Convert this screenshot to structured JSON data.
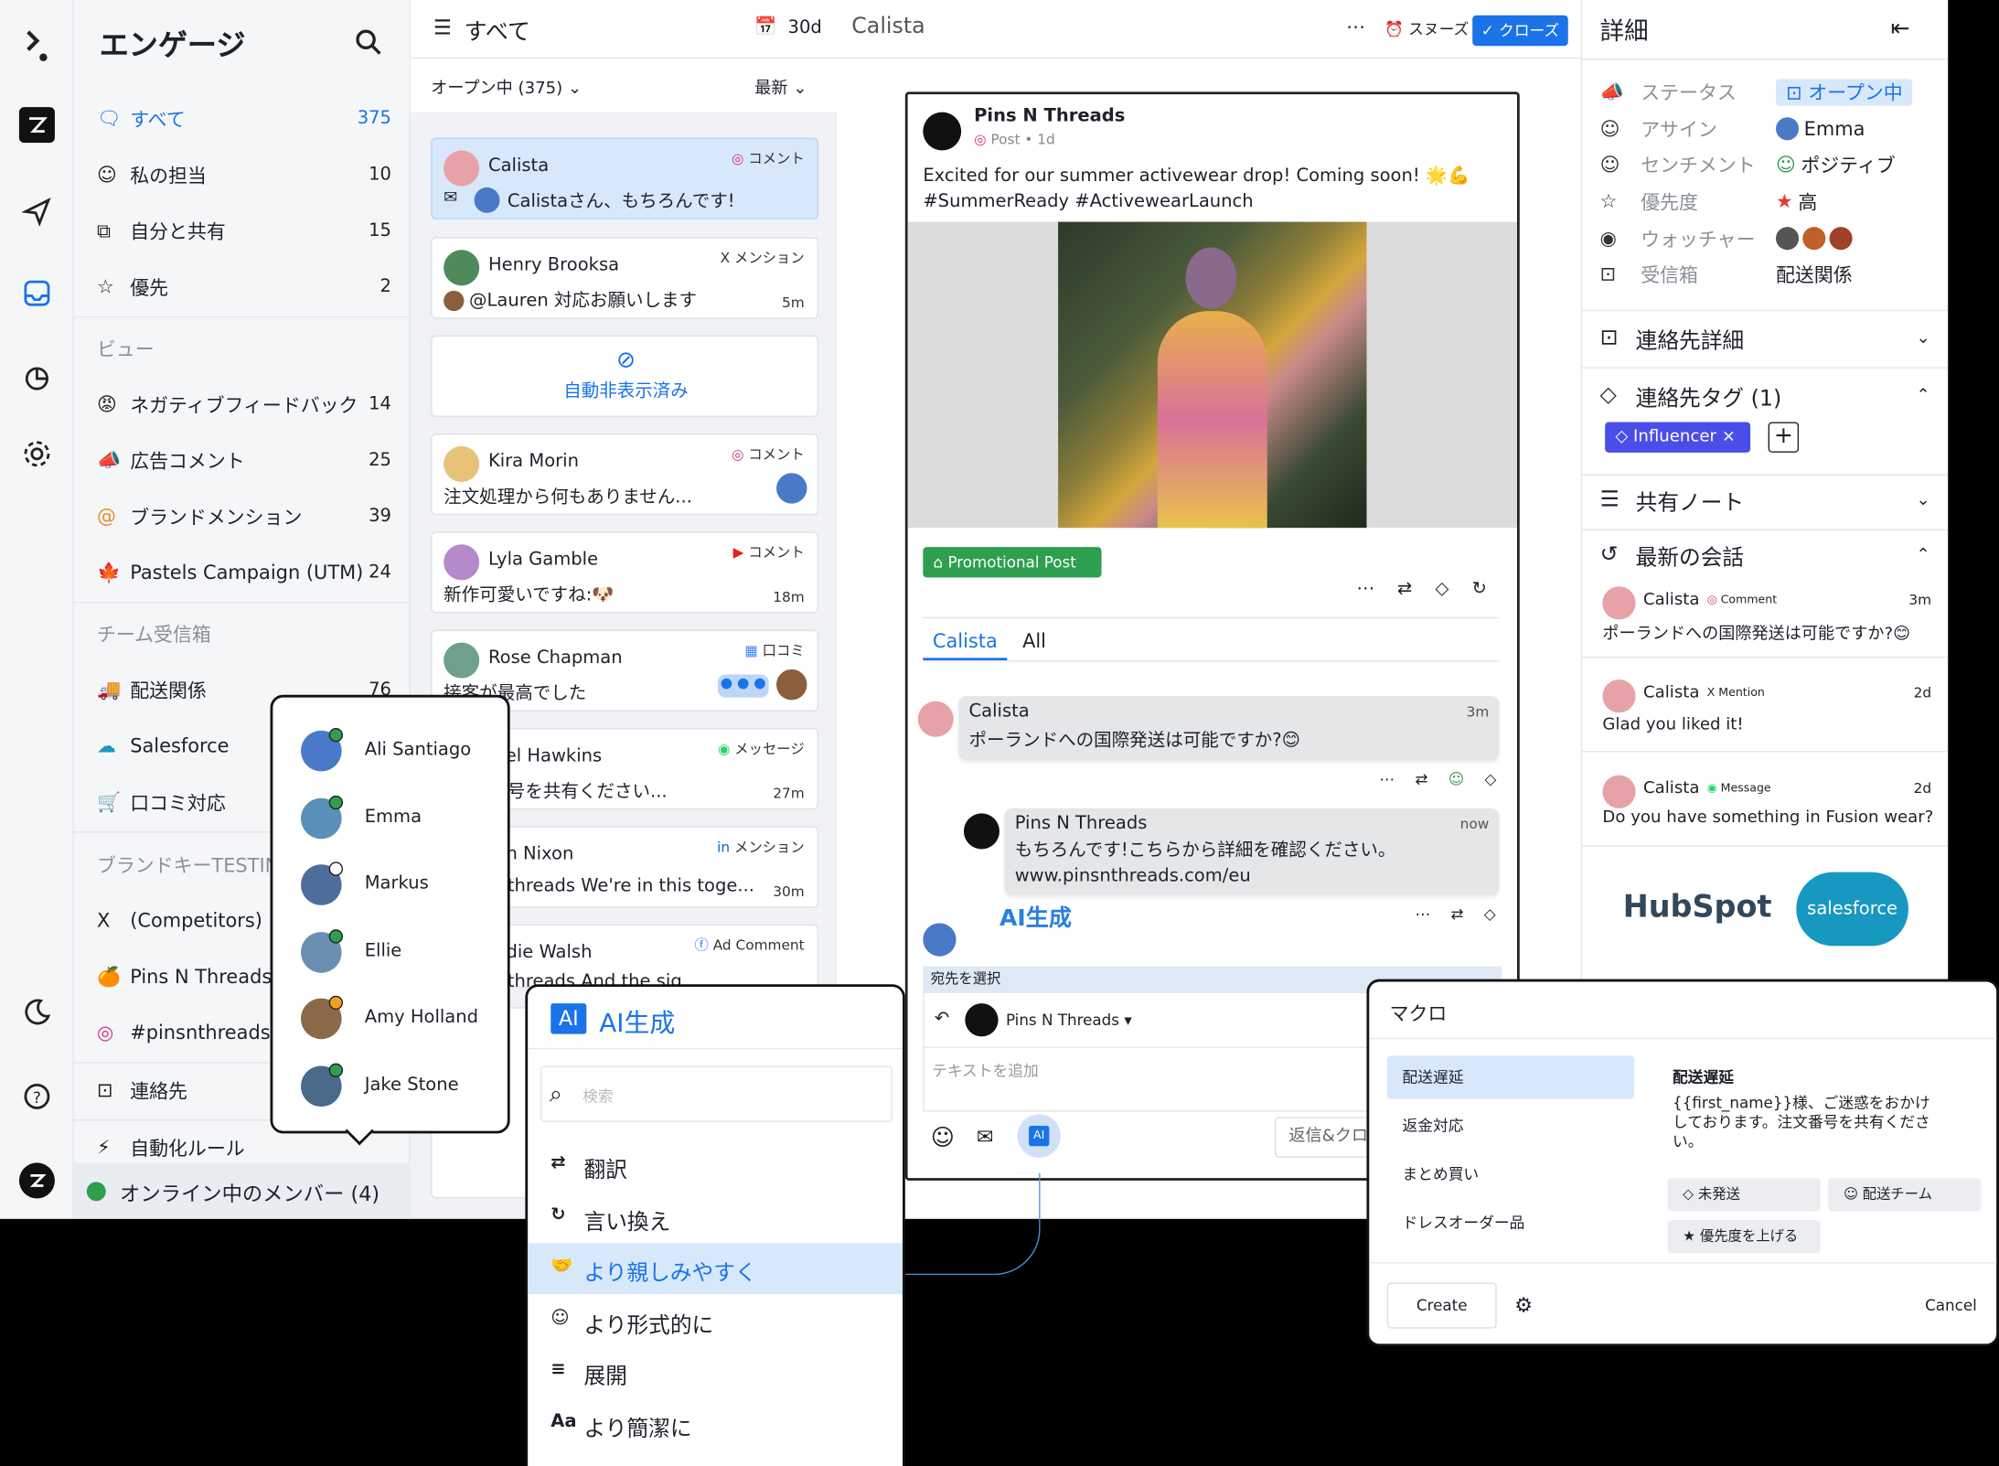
{
  "brand_letter": "ᗘ",
  "sidebar": {
    "title": "エンゲージ",
    "items": [
      {
        "icon": "🗨",
        "label": "すべて",
        "count": "375"
      },
      {
        "icon": "☺",
        "label": "私の担当",
        "count": "10"
      },
      {
        "icon": "⧉",
        "label": "自分と共有",
        "count": "15"
      },
      {
        "icon": "☆",
        "label": "優先",
        "count": "2"
      }
    ],
    "views_header": "ビュー",
    "views": [
      {
        "icon": "😡",
        "label": "ネガティブフィードバック",
        "count": "14"
      },
      {
        "icon": "📣",
        "label": "広告コメント",
        "count": "25"
      },
      {
        "icon": "@",
        "label": "ブランドメンション",
        "count": "39"
      },
      {
        "icon": "🍁",
        "label": "Pastels Campaign (UTM)",
        "count": "24"
      }
    ],
    "team_header": "チーム受信箱",
    "team": [
      {
        "icon": "🚚",
        "label": "配送関係",
        "count": "76"
      },
      {
        "icon": "☁",
        "label": "Salesforce",
        "count": ""
      },
      {
        "icon": "🛒",
        "label": "口コミ対応",
        "count": ""
      }
    ],
    "brand_header": "ブランドキーTESTIN",
    "brand": [
      {
        "icon": "X",
        "label": "(Competitors)"
      },
      {
        "icon": "🍊",
        "label": "Pins N Threads"
      },
      {
        "icon": "◎",
        "label": "#pinsnthreads"
      }
    ],
    "contacts": "連絡先",
    "automation": "自動化ルール",
    "online": "オンライン中のメンバー (4)"
  },
  "members": [
    "Ali Santiago",
    "Emma",
    "Markus",
    "Ellie",
    "Amy Holland",
    "Jake Stone"
  ],
  "list": {
    "title": "すべて",
    "range": "30d",
    "filter": "オープン中 (375)",
    "sort": "最新",
    "cards": [
      {
        "name": "Calista",
        "tag": "コメント",
        "msg": "Calistaさん、もちろんです!",
        "time": ""
      },
      {
        "name": "Henry Brooksa",
        "tag": "メンション",
        "msg": "@Lauren 対応お願いします",
        "time": "5m"
      },
      {
        "name": "Kira Morin",
        "tag": "コメント",
        "msg": "注文処理から何もありません...",
        "time": ""
      },
      {
        "name": "Lyla Gamble",
        "tag": "コメント",
        "msg": "新作可愛いですね:🐶",
        "time": "18m"
      },
      {
        "name": "Rose Chapman",
        "tag": "口コミ",
        "msg": "接客が最高でした",
        "time": ""
      },
      {
        "name": "obel Hawkins",
        "tag": "メッセージ",
        "msg": "号を共有ください...",
        "time": "27m"
      },
      {
        "name": "n Nixon",
        "tag": "メンション",
        "msg": "threads We're in this toge...",
        "time": "30m"
      },
      {
        "name": "die Walsh",
        "tag": "Ad Comment",
        "msg": "threads And the sig",
        "time": ""
      }
    ],
    "auto_hidden": "自動非表示済み"
  },
  "conversation": {
    "title": "Calista",
    "snooze": "スヌーズ",
    "close": "クローズ",
    "post_author": "Pins N Threads",
    "post_meta": "Post • 1d",
    "post_text": "Excited for our summer activewear drop! Coming soon! 🌟💪 #SummerReady #ActivewearLaunch",
    "promo_tag": "Promotional Post",
    "tabs": [
      "Calista",
      "All"
    ],
    "msg1_name": "Calista",
    "msg1_time": "3m",
    "msg1_text": "ポーランドへの国際発送は可能ですか?😊",
    "msg2_name": "Pins N Threads",
    "msg2_time": "now",
    "msg2_text": "もちろんです!こちらから詳細を確認ください。 www.pinsnthreads.com/eu",
    "ai_label": "AI生成",
    "recipient_label": "宛先を選択",
    "recipient": "Pins N Threads",
    "placeholder": "テキストを追加",
    "ai_btn": "AI",
    "reply_close": "返信&クロ"
  },
  "ai_menu": {
    "badge": "AI",
    "title": "AI生成",
    "search_placeholder": "検索",
    "items": [
      {
        "icon": "⇄",
        "label": "翻訳"
      },
      {
        "icon": "↻",
        "label": "言い換え"
      },
      {
        "icon": "🤝",
        "label": "より親しみやすく"
      },
      {
        "icon": "☺",
        "label": "より形式的に"
      },
      {
        "icon": "≡",
        "label": "展開"
      },
      {
        "icon": "Aa",
        "label": "より簡潔に"
      }
    ]
  },
  "details": {
    "title": "詳細",
    "rows": [
      {
        "icon": "📣",
        "label": "ステータス",
        "value": "オープン中"
      },
      {
        "icon": "☺",
        "label": "アサイン",
        "value": "Emma"
      },
      {
        "icon": "☺",
        "label": "センチメント",
        "value": "ポジティブ"
      },
      {
        "icon": "☆",
        "label": "優先度",
        "value": "高"
      },
      {
        "icon": "◉",
        "label": "ウォッチャー",
        "value": ""
      },
      {
        "icon": "⊡",
        "label": "受信箱",
        "value": "配送関係"
      }
    ],
    "contact_details": "連絡先詳細",
    "contact_tags": "連絡先タグ (1)",
    "tag": "Influencer",
    "shared_notes": "共有ノート",
    "recent": "最新の会話",
    "recent_items": [
      {
        "name": "Calista",
        "type": "Comment",
        "time": "3m",
        "text": "ポーランドへの国際発送は可能ですか?😊"
      },
      {
        "name": "Calista",
        "type": "Mention",
        "time": "2d",
        "text": "Glad you liked it!"
      },
      {
        "name": "Calista",
        "type": "Message",
        "time": "2d",
        "text": "Do you have something in Fusion wear?"
      }
    ],
    "hubspot": "HubSpot",
    "salesforce": "salesforce"
  },
  "macro": {
    "title": "マクロ",
    "items": [
      "配送遅延",
      "返金対応",
      "まとめ買い",
      "ドレスオーダー品"
    ],
    "selected_title": "配送遅延",
    "body": "{{first_name}}様、ご迷惑をおかけしております。注文番号を共有ください。",
    "actions": [
      "未発送",
      "配送チーム",
      "優先度を上げる"
    ],
    "create": "Create",
    "cancel": "Cancel"
  },
  "colors": {
    "accent": "#1a73e8",
    "green": "#2e9e4f",
    "tag": "#4a4de8"
  }
}
